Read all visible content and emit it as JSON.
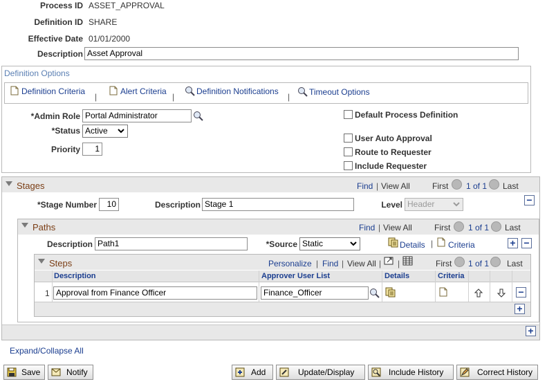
{
  "header": {
    "process_id_label": "Process ID",
    "process_id_value": "ASSET_APPROVAL",
    "definition_id_label": "Definition ID",
    "definition_id_value": "SHARE",
    "effective_date_label": "Effective Date",
    "effective_date_value": "01/01/2000",
    "description_label": "Description",
    "description_value": "Asset Approval"
  },
  "definition_options": {
    "title": "Definition Options",
    "links": {
      "criteria": "Definition Criteria",
      "alert": "Alert Criteria",
      "notifications": "Definition Notifications",
      "timeout": "Timeout Options"
    },
    "admin_role_label": "*Admin Role",
    "admin_role_value": "Portal Administrator",
    "status_label": "*Status",
    "status_value": "Active",
    "priority_label": "Priority",
    "priority_value": "1",
    "checkboxes": {
      "default_process": "Default Process Definition",
      "user_auto_approval": "User Auto Approval",
      "route_to_requester": "Route to Requester",
      "include_requester": "Include Requester"
    }
  },
  "nav": {
    "find": "Find",
    "view_all": "View All",
    "first": "First",
    "of_text": "1 of 1",
    "last": "Last",
    "personalize": "Personalize"
  },
  "stages": {
    "title": "Stages",
    "stage_number_label": "*Stage Number",
    "stage_number_value": "10",
    "description_label": "Description",
    "description_value": "Stage 1",
    "level_label": "Level",
    "level_value": "Header"
  },
  "paths": {
    "title": "Paths",
    "description_label": "Description",
    "description_value": "Path1",
    "source_label": "*Source",
    "source_value": "Static",
    "details_link": "Details",
    "criteria_link": "Criteria"
  },
  "steps": {
    "title": "Steps",
    "columns": [
      "Description",
      "Approver User List",
      "Details",
      "Criteria"
    ],
    "rows": [
      {
        "num": "1",
        "description": "Approval from Finance Officer",
        "approver": "Finance_Officer"
      }
    ]
  },
  "expand_collapse": "Expand/Collapse All",
  "toolbar": {
    "save": "Save",
    "notify": "Notify",
    "add": "Add",
    "update_display": "Update/Display",
    "include_history": "Include History",
    "correct_history": "Correct History"
  }
}
